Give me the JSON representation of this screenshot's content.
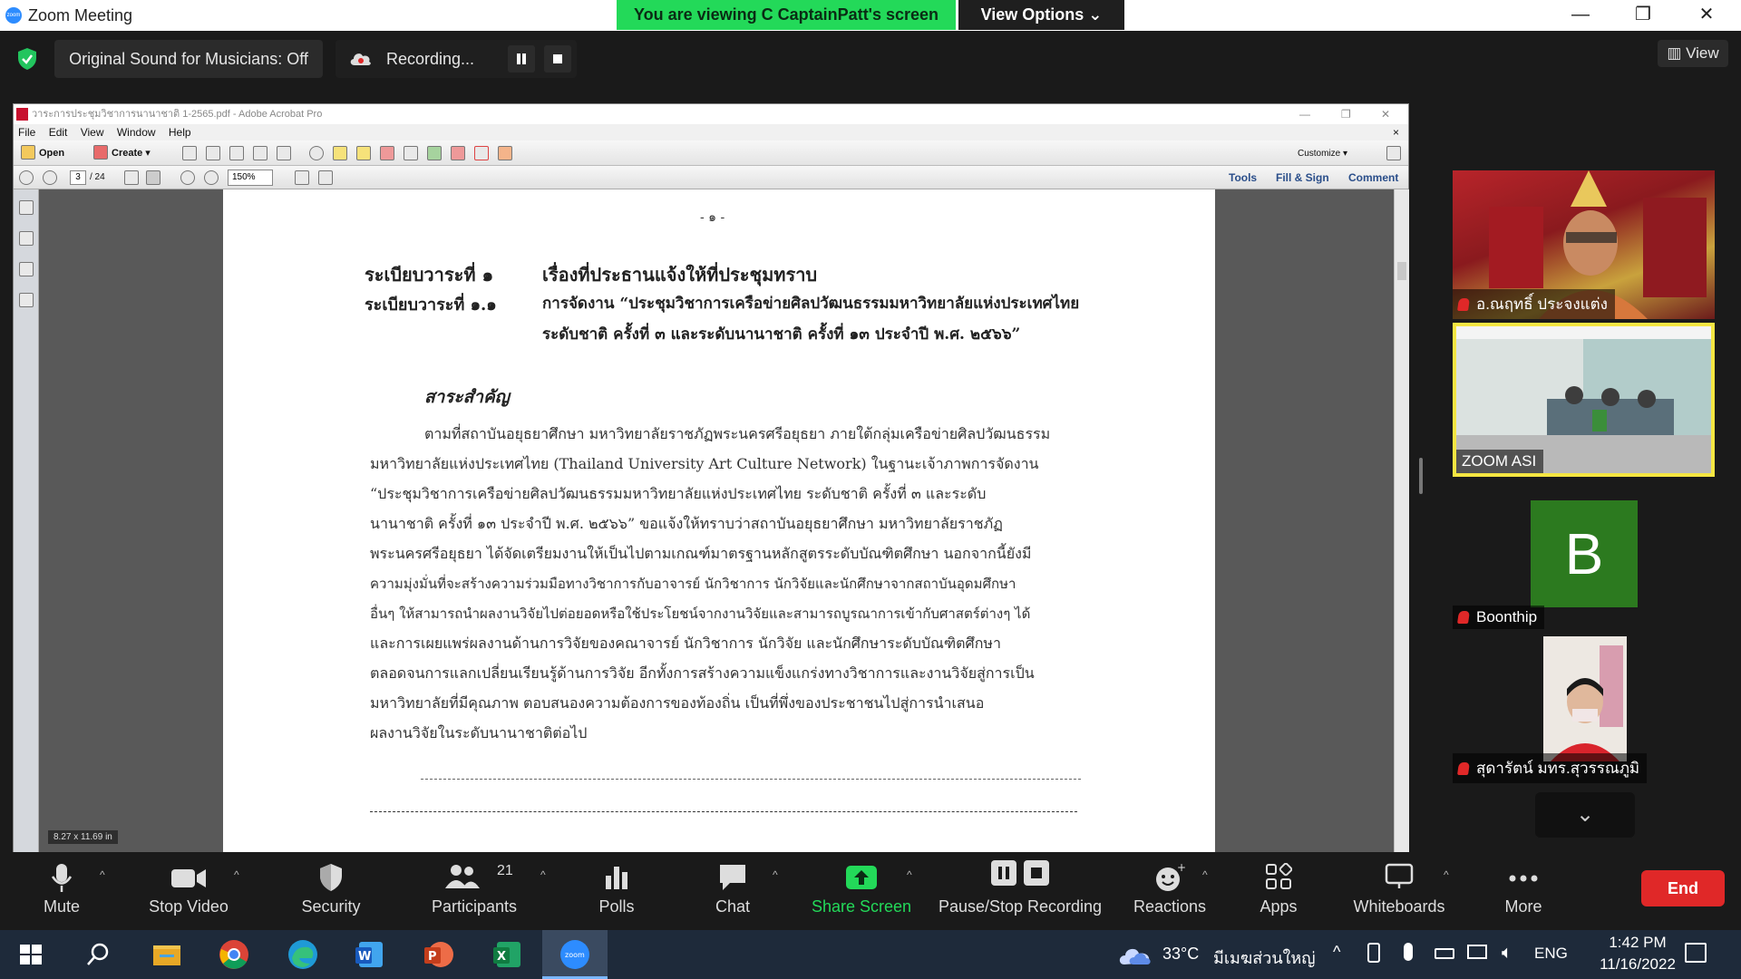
{
  "window": {
    "title": "Zoom Meeting",
    "logo_text": "zoom",
    "controls": {
      "minimize": "—",
      "maximize": "❐",
      "close": "✕"
    }
  },
  "banner": {
    "viewing": "You are viewing C CaptainPatt's screen",
    "view_options": "View Options ⌄"
  },
  "top_strip": {
    "original_sound": "Original Sound for Musicians: Off",
    "recording": "Recording...",
    "view": "View"
  },
  "acrobat": {
    "title": "วาระการประชุมวิชาการนานาชาติ 1-2565.pdf - Adobe Acrobat Pro",
    "menu": [
      "File",
      "Edit",
      "View",
      "Window",
      "Help"
    ],
    "toolbar1": {
      "open": "Open",
      "create": "Create ▾",
      "customize": "Customize ▾"
    },
    "toolbar2": {
      "page_current": "3",
      "page_total": "/ 24",
      "zoom": "150%",
      "tools": "Tools",
      "fill_sign": "Fill & Sign",
      "comment": "Comment"
    },
    "page_size": "8.27 x 11.69 in"
  },
  "document": {
    "page_number": "- ๑ -",
    "agenda1_label": "ระเบียบวาระที่ ๑",
    "agenda1_text": "เรื่องที่ประธานแจ้งให้ที่ประชุมทราบ",
    "agenda11_label": "ระเบียบวาระที่ ๑.๑",
    "agenda11_line1": "การจัดงาน “ประชุมวิชาการเครือข่ายศิลปวัฒนธรรมมหาวิทยาลัยแห่งประเทศไทย",
    "agenda11_line2": "ระดับชาติ ครั้งที่ ๓ และระดับนานาชาติ ครั้งที่ ๑๓ ประจำปี พ.ศ. ๒๕๖๖”",
    "summary_heading": "สาระสำคัญ",
    "body_lines": [
      "ตามที่สถาบันอยุธยาศึกษา มหาวิทยาลัยราชภัฏพระนครศรีอยุธยา ภายใต้กลุ่มเครือข่ายศิลปวัฒนธรรม",
      "มหาวิทยาลัยแห่งประเทศไทย (Thailand University Art Culture Network) ในฐานะเจ้าภาพการจัดงาน",
      "“ประชุมวิชาการเครือข่ายศิลปวัฒนธรรมมหาวิทยาลัยแห่งประเทศไทย ระดับชาติ ครั้งที่ ๓ และระดับ",
      "นานาชาติ ครั้งที่ ๑๓ ประจำปี พ.ศ. ๒๕๖๖” ขอแจ้งให้ทราบว่าสถาบันอยุธยาศึกษา มหาวิทยาลัยราชภัฏ",
      "พระนครศรีอยุธยา ได้จัดเตรียมงานให้เป็นไปตามเกณฑ์มาตรฐานหลักสูตรระดับบัณฑิตศึกษา นอกจากนี้ยังมี",
      "ความมุ่งมั่นที่จะสร้างความร่วมมือทางวิชาการกับอาจารย์ นักวิชาการ นักวิจัยและนักศึกษาจากสถาบันอุดมศึกษา",
      "อื่นๆ ให้สามารถนำผลงานวิจัยไปต่อยอดหรือใช้ประโยชน์จากงานวิจัยและสามารถบูรณาการเข้ากับศาสตร์ต่างๆ ได้",
      "และการเผยแพร่ผลงานด้านการวิจัยของคณาจารย์ นักวิชาการ นักวิจัย และนักศึกษาระดับบัณฑิตศึกษา",
      "ตลอดจนการแลกเปลี่ยนเรียนรู้ด้านการวิจัย อีกทั้งการสร้างความแข็งแกร่งทางวิชาการและงานวิจัยสู่การเป็น",
      "มหาวิทยาลัยที่มีคุณภาพ ตอบสนองความต้องการของท้องถิ่น เป็นที่พึ่งของประชาชนไปสู่การนำเสนอ",
      "ผลงานวิจัยในระดับนานาชาติต่อไป"
    ]
  },
  "participants": [
    {
      "name": "อ.ณฤทธิ์ ประจงแต่ง",
      "muted": true,
      "type": "video"
    },
    {
      "name": "ZOOM ASI",
      "muted": false,
      "type": "video",
      "active_speaker": true
    },
    {
      "name": "Boonthip",
      "muted": true,
      "type": "avatar",
      "initial": "B"
    },
    {
      "name": "สุดารัตน์ มทร.สุวรรณภูมิ",
      "muted": true,
      "type": "video"
    }
  ],
  "toolbar": {
    "mute": "Mute",
    "stop_video": "Stop Video",
    "security": "Security",
    "participants": "Participants",
    "participants_count": "21",
    "polls": "Polls",
    "chat": "Chat",
    "share_screen": "Share Screen",
    "pause_stop_recording": "Pause/Stop Recording",
    "reactions": "Reactions",
    "apps": "Apps",
    "whiteboards": "Whiteboards",
    "more": "More",
    "end": "End"
  },
  "taskbar": {
    "weather_temp": "33°C",
    "weather_desc": "มีเมฆส่วนใหญ่",
    "language": "ENG",
    "time": "1:42 PM",
    "date": "11/16/2022"
  },
  "colors": {
    "zoom_blue": "#2d8cff",
    "banner_green": "#23d959",
    "share_green": "#23d959",
    "end_red": "#e02828",
    "active_speaker": "#f5e642"
  }
}
